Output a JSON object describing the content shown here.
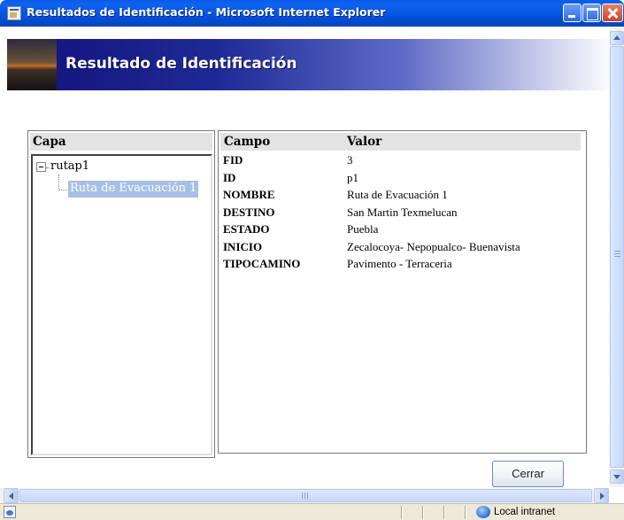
{
  "window": {
    "title": "Resultados de Identificación - Microsoft Internet Explorer",
    "controls": [
      "minimize",
      "maximize",
      "close"
    ]
  },
  "banner": {
    "title": "Resultado de Identificación"
  },
  "layers": {
    "header": "Capa",
    "tree": {
      "root": "rutap1",
      "expanded": true,
      "children": [
        {
          "label": "Ruta de Evacuación 1",
          "selected": true
        }
      ]
    }
  },
  "attributes": {
    "headers": {
      "field": "Campo",
      "value": "Valor"
    },
    "rows": [
      {
        "field": "FID",
        "value": "3"
      },
      {
        "field": "ID",
        "value": "p1"
      },
      {
        "field": "NOMBRE",
        "value": "Ruta de Evacuación 1"
      },
      {
        "field": "DESTINO",
        "value": "San Martin Texmelucan"
      },
      {
        "field": "ESTADO",
        "value": "Puebla"
      },
      {
        "field": "INICIO",
        "value": "Zecalocoya- Nepopualco- Buenavista"
      },
      {
        "field": "TIPOCAMINO",
        "value": "Pavimento - Terraceria"
      }
    ]
  },
  "actions": {
    "close_label": "Cerrar"
  },
  "statusbar": {
    "zone": "Local intranet",
    "zone_icon": "globe-icon"
  },
  "colors": {
    "titlebar": "#0554e0",
    "selection": "#a7bfe3",
    "header_bg": "#e3e3e3",
    "banner_dark": "#14117a"
  }
}
